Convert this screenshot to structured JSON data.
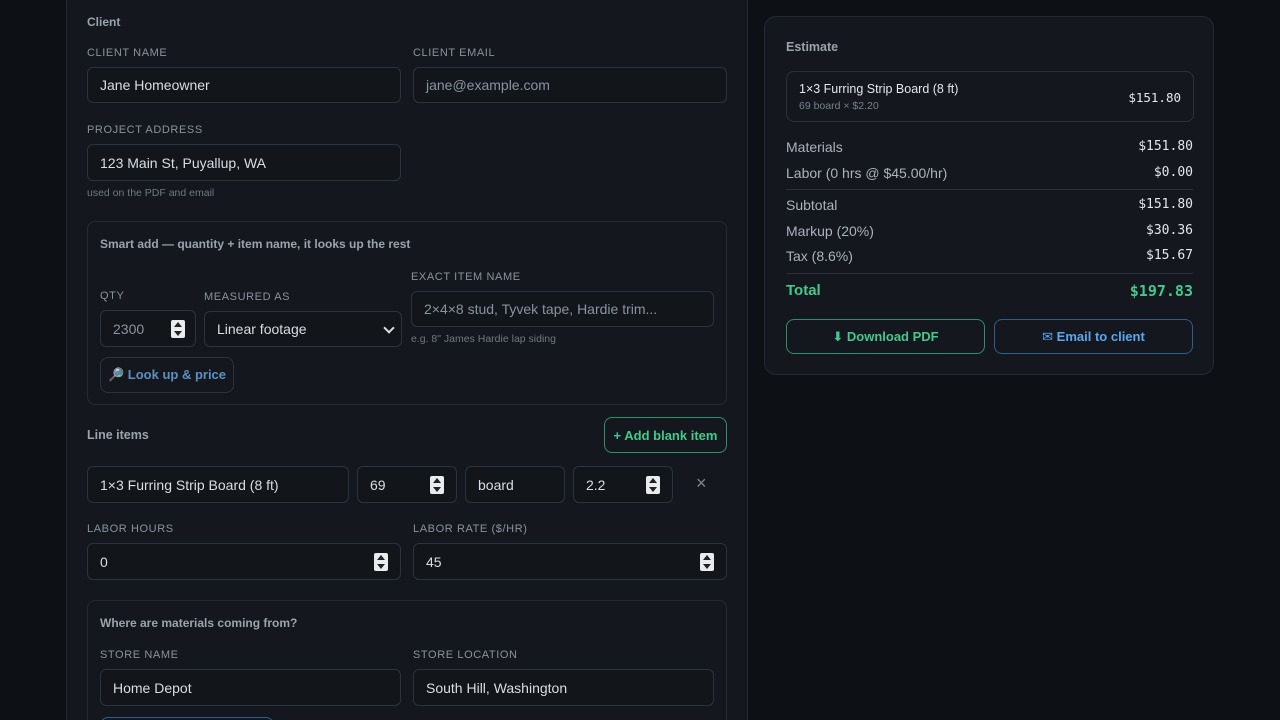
{
  "client": {
    "section_title": "Client",
    "name_label": "CLIENT NAME",
    "name_value": "Jane Homeowner",
    "email_label": "CLIENT EMAIL",
    "email_placeholder": "jane@example.com",
    "address_label": "PROJECT ADDRESS",
    "address_value": "123 Main St, Puyallup, WA",
    "address_hint": "used on the PDF and email"
  },
  "smart_add": {
    "title": "Smart add — quantity + item name, it looks up the rest",
    "qty_label": "QTY",
    "qty_placeholder": "2300",
    "measured_label": "MEASURED AS",
    "measured_value": "Linear footage",
    "item_label": "EXACT ITEM NAME",
    "item_placeholder": "2×4×8 stud, Tyvek tape, Hardie trim...",
    "item_hint": "e.g. 8\" James Hardie lap siding",
    "lookup_icon": "magnifier-icon",
    "lookup_label": "🔎 Look up & price"
  },
  "line_items": {
    "title": "Line items",
    "add_blank_label": "+ Add blank item",
    "items": [
      {
        "name": "1×3 Furring Strip Board (8 ft)",
        "qty": "69",
        "unit": "board",
        "price": "2.2",
        "remove": "×"
      }
    ]
  },
  "labor": {
    "hours_label": "LABOR HOURS",
    "hours_value": "0",
    "rate_label": "LABOR RATE ($/HR)",
    "rate_value": "45"
  },
  "materials_source": {
    "title": "Where are materials coming from?",
    "store_name_label": "STORE NAME",
    "store_name_value": "Home Depot",
    "store_location_label": "STORE LOCATION",
    "store_location_value": "South Hill, Washington"
  },
  "estimate": {
    "title": "Estimate",
    "items": [
      {
        "name": "1×3 Furring Strip Board (8 ft)",
        "detail": "69 board × $2.20",
        "amount": "$151.80"
      }
    ],
    "materials_label": "Materials",
    "materials_value": "$151.80",
    "labor_label": "Labor (0 hrs @ $45.00/hr)",
    "labor_value": "$0.00",
    "subtotal_label": "Subtotal",
    "subtotal_value": "$151.80",
    "markup_label": "Markup (20%)",
    "markup_value": "$30.36",
    "tax_label": "Tax (8.6%)",
    "tax_value": "$15.67",
    "total_label": "Total",
    "total_value": "$197.83",
    "download_label": "⬇ Download PDF",
    "email_label": "✉ Email to client"
  },
  "colors": {
    "background": "#0d1014",
    "panel": "#14181e",
    "accent_green": "#43c98b",
    "accent_blue": "#5aa6f0"
  }
}
